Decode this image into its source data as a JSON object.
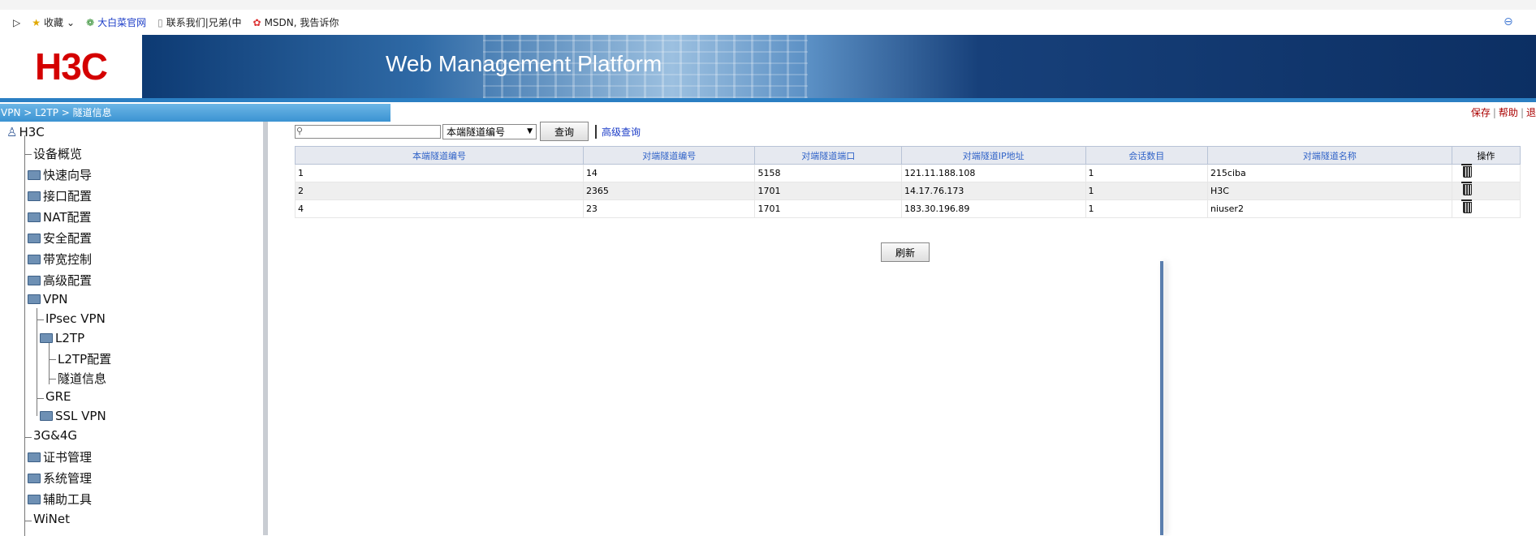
{
  "bookmarks": {
    "favorites": "收藏",
    "items": [
      "大白菜官网",
      "联系我们|兄弟(中",
      "MSDN, 我告诉你"
    ]
  },
  "banner": {
    "logo": "H3C",
    "title": "Web Management Platform"
  },
  "breadcrumb": "VPN > L2TP > 隧道信息",
  "toplinks": [
    "保存",
    "帮助",
    "退"
  ],
  "sidebar": {
    "root": "H3C",
    "items": [
      "设备概览",
      "快速向导",
      "接口配置",
      "NAT配置",
      "安全配置",
      "带宽控制",
      "高级配置",
      "VPN",
      "IPsec VPN",
      "L2TP",
      "L2TP配置",
      "隧道信息",
      "GRE",
      "SSL VPN",
      "3G&4G",
      "证书管理",
      "系统管理",
      "辅助工具",
      "WiNet"
    ]
  },
  "search": {
    "value": "",
    "select_value": "本端隧道编号",
    "query_label": "查询",
    "advanced_label": "高级查询"
  },
  "table": {
    "headers": [
      "本端隧道编号",
      "对端隧道编号",
      "对端隧道端口",
      "对端隧道IP地址",
      "会话数目",
      "对端隧道名称",
      "操作"
    ],
    "rows": [
      [
        "1",
        "14",
        "5158",
        "121.11.188.108",
        "1",
        "215ciba"
      ],
      [
        "2",
        "2365",
        "1701",
        "14.17.76.173",
        "1",
        "H3C"
      ],
      [
        "4",
        "23",
        "1701",
        "183.30.196.89",
        "1",
        "niuser2"
      ]
    ]
  },
  "refresh_label": "刷新",
  "colors": {
    "banner_blue": "#0d3a73",
    "crumb_blue": "#3b93d2",
    "logo_red": "#d40000",
    "link_blue": "#1b3cc7"
  }
}
